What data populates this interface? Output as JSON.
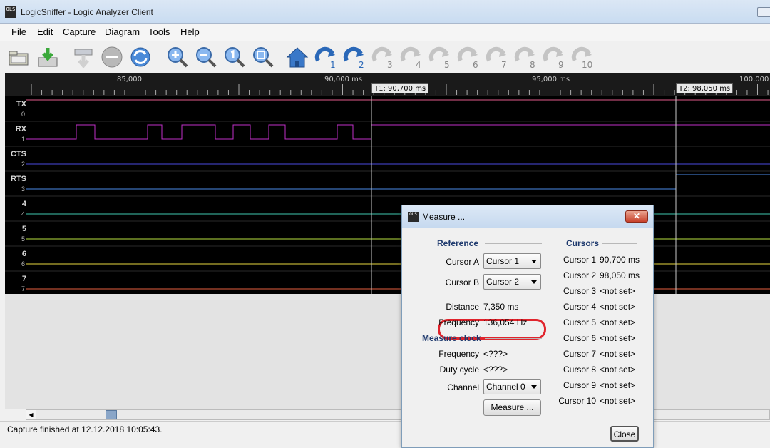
{
  "window": {
    "title": "LogicSniffer - Logic Analyzer Client",
    "app_icon_text": "OLS"
  },
  "menu": [
    {
      "label": "File",
      "key": "file"
    },
    {
      "label": "Edit",
      "key": "edit"
    },
    {
      "label": "Capture",
      "key": "capture"
    },
    {
      "label": "Diagram",
      "key": "diagram"
    },
    {
      "label": "Tools",
      "key": "tools"
    },
    {
      "label": "Help",
      "key": "help"
    }
  ],
  "toolbar": {
    "buttons": [
      "open-icon",
      "save-icon",
      "capture-icon",
      "stop-icon",
      "repeat-capture-icon",
      "zoom-in-icon",
      "zoom-out-icon",
      "zoom-original-icon",
      "zoom-all-icon",
      "goto-trigger-icon"
    ],
    "cursor_jumps": [
      "1",
      "2",
      "3",
      "4",
      "5",
      "6",
      "7",
      "8",
      "9",
      "10"
    ],
    "enabled_cursor_jumps": 2
  },
  "timeline": {
    "labels": [
      "85,000",
      "90,000 ms",
      "95,000 ms",
      "100,000"
    ],
    "cursor1_label": "T1: 90,700 ms",
    "cursor2_label": "T2: 98,050 ms"
  },
  "channels": [
    {
      "name": "TX",
      "index": "0",
      "color": "#e05a8a"
    },
    {
      "name": "RX",
      "index": "1",
      "color": "#c030c8"
    },
    {
      "name": "CTS",
      "index": "2",
      "color": "#4a4ae0"
    },
    {
      "name": "RTS",
      "index": "3",
      "color": "#4a8ae8"
    },
    {
      "name": "4",
      "index": "4",
      "color": "#40c8b0"
    },
    {
      "name": "5",
      "index": "5",
      "color": "#b8e040"
    },
    {
      "name": "6",
      "index": "6",
      "color": "#e8d840"
    },
    {
      "name": "7",
      "index": "7",
      "color": "#e86040"
    }
  ],
  "status": {
    "text": "Capture finished at 12.12.2018 10:05:43."
  },
  "dialog": {
    "title": "Measure ...",
    "reference": {
      "heading": "Reference",
      "cursor_a_label": "Cursor A",
      "cursor_a_value": "Cursor 1",
      "cursor_b_label": "Cursor B",
      "cursor_b_value": "Cursor 2",
      "distance_label": "Distance",
      "distance_value": "7,350 ms",
      "frequency_label": "Frequency",
      "frequency_value": "136,054 Hz"
    },
    "measure_clock": {
      "heading": "Measure clock",
      "frequency_label": "Frequency",
      "frequency_value": "<???>",
      "duty_label": "Duty cycle",
      "duty_value": "<???>",
      "channel_label": "Channel",
      "channel_value": "Channel 0",
      "measure_button": "Measure ..."
    },
    "cursors": {
      "heading": "Cursors",
      "items": [
        {
          "label": "Cursor 1",
          "value": "90,700 ms"
        },
        {
          "label": "Cursor 2",
          "value": "98,050 ms"
        },
        {
          "label": "Cursor 3",
          "value": "<not set>"
        },
        {
          "label": "Cursor 4",
          "value": "<not set>"
        },
        {
          "label": "Cursor 5",
          "value": "<not set>"
        },
        {
          "label": "Cursor 6",
          "value": "<not set>"
        },
        {
          "label": "Cursor 7",
          "value": "<not set>"
        },
        {
          "label": "Cursor 8",
          "value": "<not set>"
        },
        {
          "label": "Cursor 9",
          "value": "<not set>"
        },
        {
          "label": "Cursor 10",
          "value": "<not set>"
        }
      ]
    },
    "close_button": "Close"
  }
}
